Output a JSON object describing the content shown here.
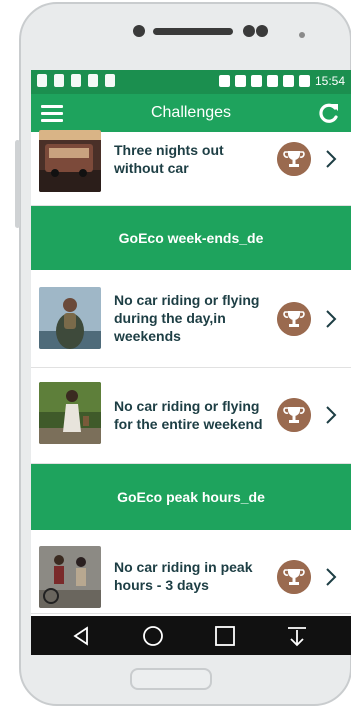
{
  "app": {
    "title": "Challenges"
  },
  "status": {
    "time": "15:54"
  },
  "challenges": {
    "item_1": {
      "label": "Three nights out without car"
    },
    "header_1": {
      "label": "GoEco week-ends_de"
    },
    "item_2": {
      "label": "No car riding or flying during the day,in weekends"
    },
    "item_3": {
      "label": "No car riding or flying for the entire weekend"
    },
    "header_2": {
      "label": "GoEco peak hours_de"
    },
    "item_4": {
      "label": "No car riding in peak hours - 3 days"
    }
  },
  "colors": {
    "accent": "#1ea35d",
    "trophy": "#9a6a4f",
    "text": "#1d3e44"
  },
  "icons": {
    "menu": "menu-icon",
    "refresh": "refresh-icon",
    "trophy": "trophy-icon",
    "chevron": "chevron-right-icon"
  }
}
